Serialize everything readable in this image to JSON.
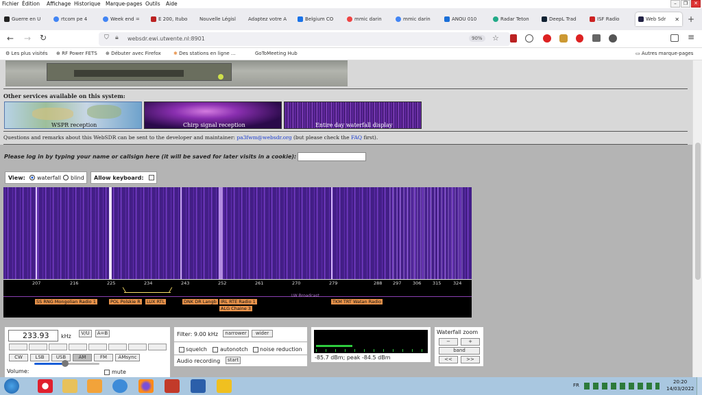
{
  "menu": [
    "Fichier",
    "Édition",
    "Affichage",
    "Historique",
    "Marque-pages",
    "Outils",
    "Aide"
  ],
  "tabs": [
    {
      "label": "Guerre en U",
      "color": "#222"
    },
    {
      "label": "rtcom pe 4",
      "color": "#4285f4"
    },
    {
      "label": "Week end =",
      "color": "#4285f4"
    },
    {
      "label": "E 200, Itubo",
      "color": "#b22"
    },
    {
      "label": "Nouvelle Législ",
      "color": "#888"
    },
    {
      "label": "Adaptez votre A",
      "color": "#888"
    },
    {
      "label": "Belgium CO",
      "color": "#1a73e8"
    },
    {
      "label": "mmic darin",
      "color": "#e44"
    },
    {
      "label": "mmic darin",
      "color": "#4285f4"
    },
    {
      "label": "ANOU 010",
      "color": "#1a6fd8"
    },
    {
      "label": "Radar Teton",
      "color": "#2a8"
    },
    {
      "label": "DeepL Trad",
      "color": "#123"
    },
    {
      "label": "ISF Radio",
      "color": "#c22"
    },
    {
      "label": "Web Sdr",
      "color": "#224"
    }
  ],
  "nav": {
    "url": "websdr.ewi.utwente.nl:8901",
    "zoom": "90%"
  },
  "bookmarks": [
    "Les plus visités",
    "RF Power FETS",
    "Débuter avec Firefox",
    "Des stations en ligne ...",
    "GoToMeeting Hub",
    "Autres marque-pages"
  ],
  "page": {
    "other_services": "Other services available on this system:",
    "thumbs": [
      "WSPR reception",
      "Chirp signal reception",
      "Entire day waterfall display"
    ],
    "questions": "Questions and remarks about this WebSDR can be sent to the developer and maintainer:",
    "email": "pa3fwm@websdr.org",
    "faq_pre": "(but please check the",
    "faq_link": "FAQ",
    "faq_post": "first).",
    "login_prompt": "Please log in by typing your name or callsign here (it will be saved for later visits in a cookie):",
    "view_label": "View:",
    "view_waterfall": "waterfall",
    "view_blind": "blind",
    "allow_keyboard": "Allow keyboard:"
  },
  "scale": {
    "ticks": [
      "207",
      "216",
      "225",
      "234",
      "243",
      "252",
      "261",
      "270",
      "279",
      "288",
      "297",
      "306",
      "315",
      "324"
    ],
    "band_label": "LW Broadcast",
    "stations": [
      "SS RNG Mongolian Radio 1",
      "POL Polskie R",
      "LUX RTL",
      "DNK DR Langb",
      "IRL RTE Radio 1",
      "ALG Chaine 3",
      "TKM TRT Watan Radio"
    ]
  },
  "controls": {
    "freq": "233.93",
    "unit": "kHz",
    "vu": "V/U",
    "ab": "A=B",
    "modes": [
      "CW",
      "LSB",
      "USB",
      "AM",
      "FM",
      "AMsync"
    ],
    "volume": "Volume:",
    "mute": "mute",
    "filter_text": "Filter: 9.00 kHz",
    "narrower": "narrower",
    "wider": "wider",
    "squelch": "squelch",
    "autonotch": "autonotch",
    "noise_reduction": "noise reduction",
    "audio_recording": "Audio recording",
    "start": "start",
    "smeter_text": "-85.7 dBm; peak -84.5 dBm",
    "wf_zoom": "Waterfall zoom",
    "zoom_minus": "−",
    "zoom_plus": "+",
    "band": "band",
    "left": "<<",
    "right": ">>"
  },
  "taskbar": {
    "lang": "FR",
    "time": "20:20",
    "date": "14/03/2022"
  },
  "colors": {
    "waterfall_bg": "#3c1a7a",
    "accent_orange": "#e8924a",
    "link": "#1a3ccf"
  }
}
